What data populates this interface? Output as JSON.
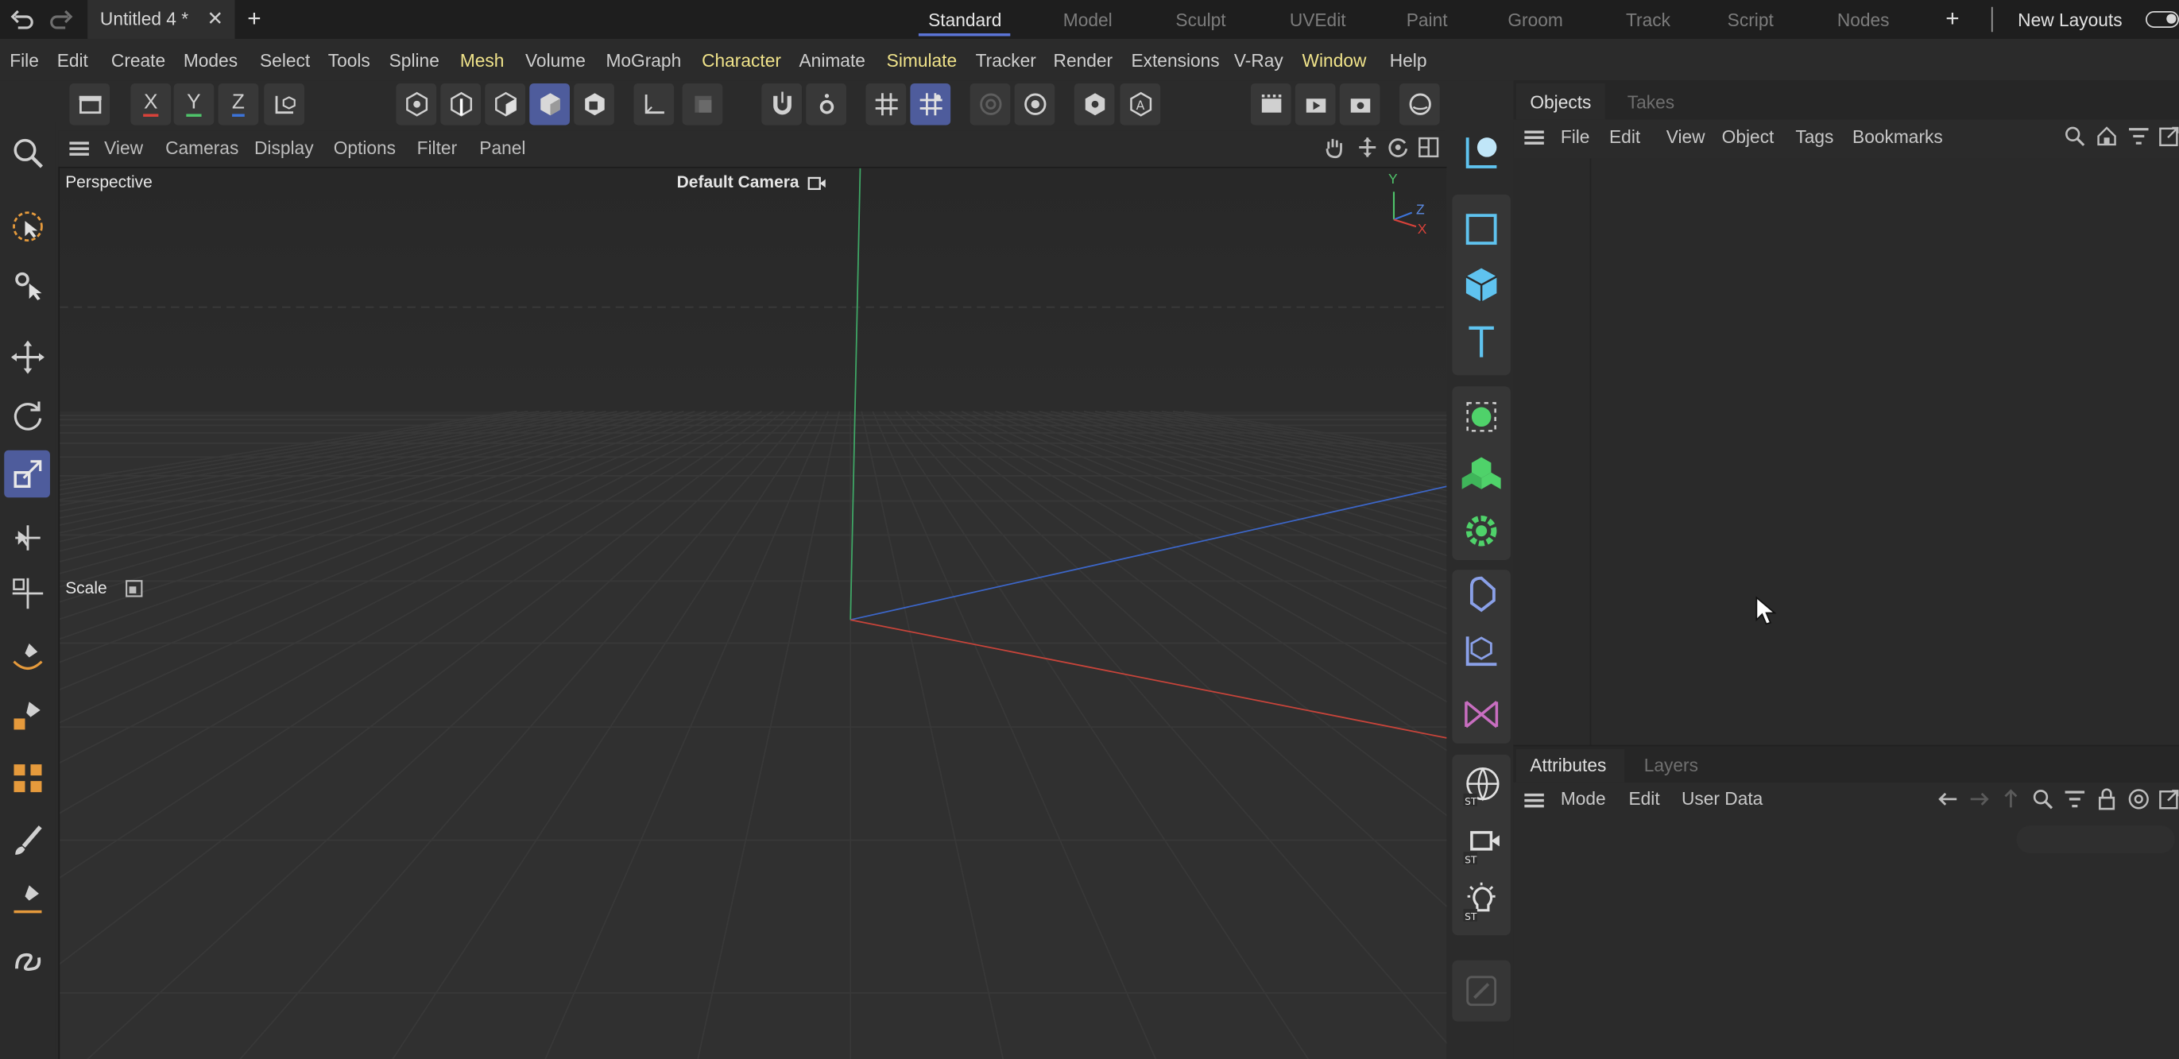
{
  "titlebar": {
    "undo_icon": "undo-icon",
    "redo_icon": "redo-icon",
    "document_tab": "Untitled 4 *",
    "close_glyph": "✕",
    "add_glyph": "+",
    "layouts": [
      "Standard",
      "Model",
      "Sculpt",
      "UVEdit",
      "Paint",
      "Groom",
      "Track",
      "Script",
      "Nodes"
    ],
    "active_layout": "Standard",
    "new_layouts": "New Layouts"
  },
  "menubar": {
    "items": [
      "File",
      "Edit",
      "Create",
      "Modes",
      "Select",
      "Tools",
      "Spline",
      "Mesh",
      "Volume",
      "MoGraph",
      "Character",
      "Animate",
      "Simulate",
      "Tracker",
      "Render",
      "Extensions",
      "V-Ray",
      "Window",
      "Help"
    ],
    "highlighted": [
      "Mesh",
      "Character",
      "Simulate",
      "Window"
    ]
  },
  "toolbar": {
    "axis_labels": [
      "X",
      "Y",
      "Z"
    ]
  },
  "viewport": {
    "menu": [
      "View",
      "Cameras",
      "Display",
      "Options",
      "Filter",
      "Panel"
    ],
    "view_name": "Perspective",
    "camera": "Default Camera",
    "tool_label": "Scale",
    "axis_gizmo": [
      "Y",
      "Z",
      "X"
    ]
  },
  "objects_panel": {
    "tabs": [
      "Objects",
      "Takes"
    ],
    "menu": [
      "File",
      "Edit",
      "View",
      "Object",
      "Tags",
      "Bookmarks"
    ]
  },
  "attributes_panel": {
    "tabs": [
      "Attributes",
      "Layers"
    ],
    "menu": [
      "Mode",
      "Edit",
      "User Data"
    ]
  },
  "colors": {
    "accent": "#4e5c9c",
    "menu_highlight": "#f0e38a",
    "axis_x": "#d9423a",
    "axis_y": "#4fc46a",
    "axis_z": "#3c73d8",
    "green_object": "#4fd26a",
    "cyan_object": "#5fc3ef"
  }
}
